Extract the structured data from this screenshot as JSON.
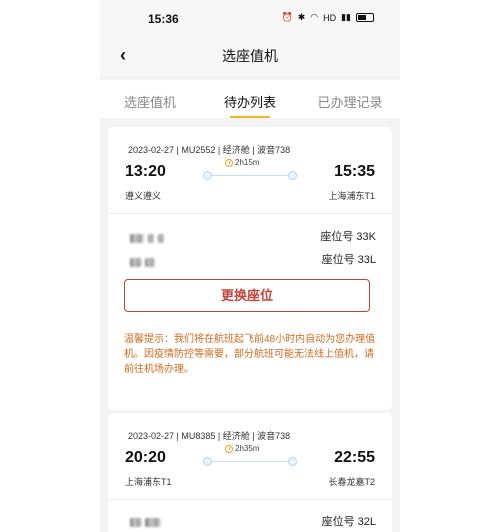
{
  "status_bar": {
    "time": "15:36",
    "icons": [
      "alarm-icon",
      "bluetooth-icon",
      "wifi-icon",
      "hd-icon",
      "signal-icon",
      "battery-icon"
    ]
  },
  "nav": {
    "title": "选座值机",
    "back_icon": "chevron-left-icon"
  },
  "tabs": [
    {
      "label": "选座值机",
      "active": false
    },
    {
      "label": "待办列表",
      "active": true
    },
    {
      "label": "已办理记录",
      "active": false
    }
  ],
  "flights": [
    {
      "meta": "2023-02-27 | MU2552 | 经济舱 | 波音738",
      "departure_time": "13:20",
      "arrival_time": "15:35",
      "departure_airport": "遵义遵义",
      "arrival_airport": "上海浦东T1",
      "duration": "2h15m",
      "passengers": [
        {
          "seat": "座位号 33K"
        },
        {
          "seat": "座位号 33L"
        }
      ],
      "change_seat_label": "更换座位",
      "tip": "温馨提示：我们将在航班起飞前48小时内自动为您办理值机。因疫情防控等需要，部分航班可能无法线上值机，请前往机场办理。"
    },
    {
      "meta": "2023-02-27 | MU8385 | 经济舱 | 波音738",
      "departure_time": "20:20",
      "arrival_time": "22:55",
      "departure_airport": "上海浦东T1",
      "arrival_airport": "长春龙嘉T2",
      "duration": "2h35m",
      "passengers": [
        {
          "seat": "座位号 32L"
        }
      ]
    }
  ],
  "colors": {
    "accent": "#f2b824",
    "button": "#c2433a",
    "tip": "#d2691e"
  }
}
